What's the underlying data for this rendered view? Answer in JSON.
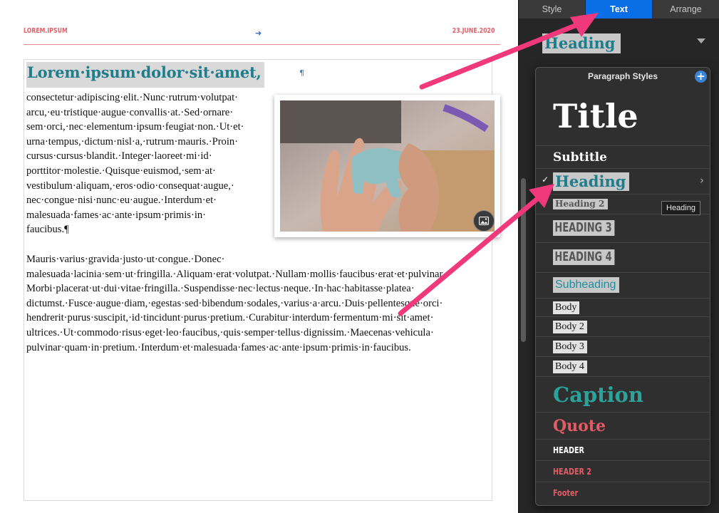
{
  "document": {
    "header_left": "LOREM.IPSUM",
    "header_center_icon": "blue-arrow-icon",
    "header_right": "23.JUNE.2020",
    "heading": "Lorem·ipsum·dolor·sit·amet,",
    "pilcrow": "¶",
    "paragraph1_lines": [
      "consectetur·adipiscing·elit.·Nunc·rutrum·volutpat·",
      "arcu,·eu·tristique·augue·convallis·at.·Sed·ornare·",
      "sem·orci,·nec·elementum·ipsum·feugiat·non.·Ut·et·",
      "urna·tempus,·dictum·nisl·a,·rutrum·mauris.·Proin·",
      "cursus·cursus·blandit.·Integer·laoreet·mi·id·",
      "porttitor·molestie.·Quisque·euismod,·sem·at·",
      "vestibulum·aliquam,·eros·odio·consequat·augue,·",
      "nec·congue·nisi·nunc·eu·augue.·Interdum·et·",
      "malesuada·fames·ac·ante·ipsum·primis·in·",
      "faucibus.¶"
    ],
    "paragraph2_lines": [
      "Mauris·varius·gravida·justo·ut·congue.·Donec·",
      "malesuada·lacinia·sem·ut·fringilla.·Aliquam·erat·volutpat.·Nullam·mollis·faucibus·erat·et·pulvinar.·",
      "Morbi·placerat·ut·dui·vitae·fringilla.·Suspendisse·nec·lectus·neque.·In·hac·habitasse·platea·",
      "dictumst.·Fusce·augue·diam,·egestas·sed·bibendum·sodales,·varius·a·arcu.·Duis·pellentesque·orci·",
      "hendrerit·purus·suscipit,·id·tincidunt·purus·pretium.·Curabitur·interdum·fermentum·mi·sit·amet·",
      "ultrices.·Ut·commodo·risus·eget·leo·faucibus,·quis·semper·tellus·dignissim.·Maecenas·vehicula·",
      "pulvinar·quam·in·pretium.·Interdum·et·malesuada·fames·ac·ante·ipsum·primis·in·faucibus."
    ],
    "image_badge_icon": "image-icon"
  },
  "inspector": {
    "tabs": [
      {
        "label": "Style",
        "active": false
      },
      {
        "label": "Text",
        "active": true
      },
      {
        "label": "Arrange",
        "active": false
      }
    ],
    "current_style": "Heading",
    "popup_title": "Paragraph Styles",
    "styles": [
      {
        "label": "Title"
      },
      {
        "label": "Subtitle"
      },
      {
        "label": "Heading",
        "selected": true
      },
      {
        "label": "Heading 2"
      },
      {
        "label": "HEADING 3"
      },
      {
        "label": "HEADING 4"
      },
      {
        "label": "Subheading"
      },
      {
        "label": "Body"
      },
      {
        "label": "Body 2"
      },
      {
        "label": "Body 3"
      },
      {
        "label": "Body 4"
      },
      {
        "label": "Caption"
      },
      {
        "label": "Quote"
      },
      {
        "label": "HEADER"
      },
      {
        "label": "HEADER 2"
      },
      {
        "label": "Footer"
      }
    ],
    "tooltip": "Heading"
  },
  "colors": {
    "accent_blue": "#0a6ee6",
    "heading_teal": "#1f7d8c",
    "header_red": "#e0616b",
    "annotation_arrow": "#f0397a"
  }
}
